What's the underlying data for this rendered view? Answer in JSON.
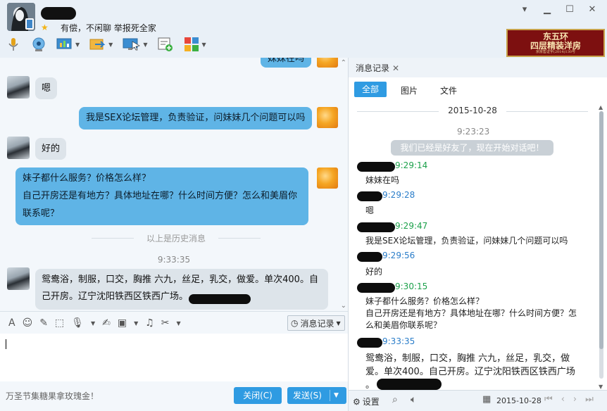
{
  "contact": {
    "signature": "有偿，不闲聊  举报死全家"
  },
  "window": {
    "min": "▁",
    "max": "☐",
    "close": "✕",
    "skin": "▾"
  },
  "toolbar": {
    "icons": [
      "mic-icon",
      "video-call-icon",
      "screen-share-icon",
      "file-transfer-icon",
      "remote-desktop-icon",
      "add-app-icon",
      "app-grid-icon"
    ]
  },
  "ad": {
    "line1": "东五环",
    "line2": "四层精装洋房",
    "line3": "京房售证字(2014)130号"
  },
  "chat": {
    "top_partial": "妹妹在吗",
    "messages": [
      {
        "side": "in",
        "text": "嗯"
      },
      {
        "side": "out",
        "text": "我是SEX论坛管理，负责验证，问妹妹几个问题可以吗"
      },
      {
        "side": "in",
        "text": "好的"
      },
      {
        "side": "out",
        "line1": "妹子都什么服务？价格怎么样？",
        "line2": "自己开房还是有地方？具体地址在哪？什么时间方便？怎么和美眉你",
        "line3": "联系呢？"
      }
    ],
    "history_divider": "以上是历史消息",
    "time": "9:33:35",
    "last_in_line1": "鸳鸯浴，制服，口交，胸推 六九，丝足，乳交，做爱。单次400。自",
    "last_in_line2": "己开房。辽宁沈阳铁西区铁西广场。"
  },
  "input_toolbar": {
    "icons": [
      "font-icon",
      "emoji-icon",
      "nudge-icon",
      "screenshot-icon",
      "voice-icon",
      "edit-icon",
      "image-icon",
      "music-icon",
      "scissors-icon"
    ],
    "history_label": "消息记录"
  },
  "footer": {
    "promo": "万圣节集糖果拿玫瑰金！",
    "close_label": "关闭(C)",
    "send_label": "发送(S)"
  },
  "history": {
    "tab_label": "消息记录",
    "filters": {
      "all": "全部",
      "pictures": "图片",
      "files": "文件"
    },
    "date": "2015-10-28",
    "first_time": "9:23:23",
    "system_msg": "我们已经是好友了，现在开始对话吧！",
    "entries": [
      {
        "time": "9:29:14",
        "color": "green",
        "text": "妹妹在吗"
      },
      {
        "time": "9:29:28",
        "color": "blue",
        "text": "嗯"
      },
      {
        "time": "9:29:47",
        "color": "green",
        "text": "我是SEX论坛管理，负责验证，问妹妹几个问题可以吗"
      },
      {
        "time": "9:29:56",
        "color": "blue",
        "text": "好的"
      },
      {
        "time": "9:30:15",
        "color": "green",
        "line1": "妹子都什么服务？价格怎么样？",
        "line2": "自己开房还是有地方？具体地址在哪？什么时间方便？怎",
        "line3": "么和美眉你联系呢？"
      },
      {
        "time": "9:33:35",
        "color": "blue",
        "line1": "鸳鸯浴，制服，口交，胸推 六九，丝足，乳交，做",
        "line2": "爱。单次400。自己开房。辽宁沈阳铁西区铁西广场",
        "line3": "。"
      }
    ],
    "settings_label": "设置",
    "footer_date": "2015-10-28"
  }
}
